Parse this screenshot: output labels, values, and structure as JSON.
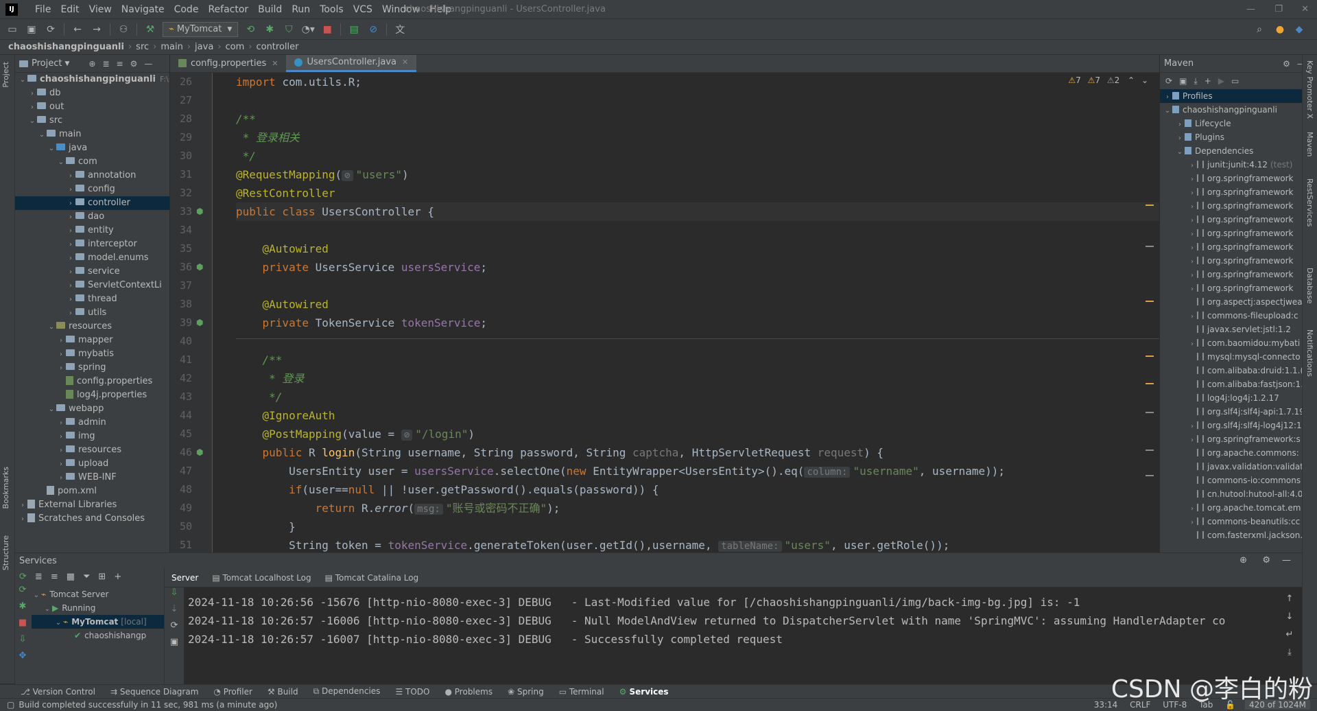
{
  "menubar": {
    "logo": "IJ",
    "items": [
      "File",
      "Edit",
      "View",
      "Navigate",
      "Code",
      "Refactor",
      "Build",
      "Run",
      "Tools",
      "VCS",
      "Window",
      "Help"
    ],
    "window_title": "chaoshishangpinguanli - UsersController.java"
  },
  "toolbar": {
    "run_config": "MyTomcat"
  },
  "breadcrumb": [
    "chaoshishangpinguanli",
    "src",
    "main",
    "java",
    "com",
    "controller"
  ],
  "project": {
    "title": "Project",
    "tree": [
      {
        "label": "chaoshishangpinguanli",
        "hint": "F:\\ssm",
        "depth": 0,
        "arrow": "v",
        "kind": "folder",
        "bold": true
      },
      {
        "label": "db",
        "depth": 1,
        "arrow": ">",
        "kind": "folder"
      },
      {
        "label": "out",
        "depth": 1,
        "arrow": ">",
        "kind": "folder"
      },
      {
        "label": "src",
        "depth": 1,
        "arrow": "v",
        "kind": "folder"
      },
      {
        "label": "main",
        "depth": 2,
        "arrow": "v",
        "kind": "folder"
      },
      {
        "label": "java",
        "depth": 3,
        "arrow": "v",
        "kind": "src"
      },
      {
        "label": "com",
        "depth": 4,
        "arrow": "v",
        "kind": "folder"
      },
      {
        "label": "annotation",
        "depth": 5,
        "arrow": ">",
        "kind": "folder"
      },
      {
        "label": "config",
        "depth": 5,
        "arrow": ">",
        "kind": "folder"
      },
      {
        "label": "controller",
        "depth": 5,
        "arrow": ">",
        "kind": "folder",
        "selected": true
      },
      {
        "label": "dao",
        "depth": 5,
        "arrow": ">",
        "kind": "folder"
      },
      {
        "label": "entity",
        "depth": 5,
        "arrow": ">",
        "kind": "folder"
      },
      {
        "label": "interceptor",
        "depth": 5,
        "arrow": ">",
        "kind": "folder"
      },
      {
        "label": "model.enums",
        "depth": 5,
        "arrow": ">",
        "kind": "folder"
      },
      {
        "label": "service",
        "depth": 5,
        "arrow": ">",
        "kind": "folder"
      },
      {
        "label": "ServletContextLi",
        "depth": 5,
        "arrow": ">",
        "kind": "folder"
      },
      {
        "label": "thread",
        "depth": 5,
        "arrow": ">",
        "kind": "folder"
      },
      {
        "label": "utils",
        "depth": 5,
        "arrow": ">",
        "kind": "folder"
      },
      {
        "label": "resources",
        "depth": 3,
        "arrow": "v",
        "kind": "res"
      },
      {
        "label": "mapper",
        "depth": 4,
        "arrow": ">",
        "kind": "folder"
      },
      {
        "label": "mybatis",
        "depth": 4,
        "arrow": ">",
        "kind": "folder"
      },
      {
        "label": "spring",
        "depth": 4,
        "arrow": ">",
        "kind": "folder"
      },
      {
        "label": "config.properties",
        "depth": 4,
        "arrow": "",
        "kind": "prop"
      },
      {
        "label": "log4j.properties",
        "depth": 4,
        "arrow": "",
        "kind": "prop"
      },
      {
        "label": "webapp",
        "depth": 3,
        "arrow": "v",
        "kind": "folder"
      },
      {
        "label": "admin",
        "depth": 4,
        "arrow": ">",
        "kind": "folder"
      },
      {
        "label": "img",
        "depth": 4,
        "arrow": ">",
        "kind": "folder"
      },
      {
        "label": "resources",
        "depth": 4,
        "arrow": ">",
        "kind": "folder"
      },
      {
        "label": "upload",
        "depth": 4,
        "arrow": ">",
        "kind": "folder"
      },
      {
        "label": "WEB-INF",
        "depth": 4,
        "arrow": ">",
        "kind": "folder"
      },
      {
        "label": "pom.xml",
        "depth": 2,
        "arrow": "",
        "kind": "file"
      },
      {
        "label": "External Libraries",
        "depth": 0,
        "arrow": ">",
        "kind": "lib"
      },
      {
        "label": "Scratches and Consoles",
        "depth": 0,
        "arrow": ">",
        "kind": "lib"
      }
    ]
  },
  "editor": {
    "tabs": [
      {
        "label": "config.properties",
        "active": false
      },
      {
        "label": "UsersController.java",
        "active": true
      }
    ],
    "warnings": {
      "w1": "7",
      "w2": "7",
      "w3": "2"
    },
    "lines": [
      {
        "n": "26",
        "html": "<span class=\"kw\">import </span>com.utils.R;"
      },
      {
        "n": "27",
        "html": ""
      },
      {
        "n": "28",
        "html": "<span class=\"cm\">/**</span>"
      },
      {
        "n": "29",
        "html": "<span class=\"cm\"> * 登录相关</span>"
      },
      {
        "n": "30",
        "html": "<span class=\"cm\"> */</span>"
      },
      {
        "n": "31",
        "html": "<span class=\"an\">@RequestMapping</span>(<span class=\"hint\">⊘</span><span class=\"st\">\"users\"</span>)"
      },
      {
        "n": "32",
        "html": "<span class=\"an\">@RestController</span>"
      },
      {
        "n": "33",
        "html": "<span class=\"kw\">public class </span>UsersController {",
        "cur": true
      },
      {
        "n": "34",
        "html": ""
      },
      {
        "n": "35",
        "html": "    <span class=\"an\">@Autowired</span>"
      },
      {
        "n": "36",
        "html": "    <span class=\"kw\">private </span>UsersService <span class=\"fl\">usersService</span>;"
      },
      {
        "n": "37",
        "html": ""
      },
      {
        "n": "38",
        "html": "    <span class=\"an\">@Autowired</span>"
      },
      {
        "n": "39",
        "html": "    <span class=\"kw\">private </span>TokenService <span class=\"fl\">tokenService</span>;"
      },
      {
        "n": "40",
        "html": ""
      },
      {
        "n": "41",
        "html": "    <span class=\"cm\">/**</span>"
      },
      {
        "n": "42",
        "html": "    <span class=\"cm\"> * 登录</span>"
      },
      {
        "n": "43",
        "html": "    <span class=\"cm\"> */</span>"
      },
      {
        "n": "44",
        "html": "    <span class=\"an\">@IgnoreAuth</span>"
      },
      {
        "n": "45",
        "html": "    <span class=\"an\">@PostMapping</span>(value = <span class=\"hint\">⊘</span><span class=\"st\">\"/login\"</span>)"
      },
      {
        "n": "46",
        "html": "    <span class=\"kw\">public </span>R <span class=\"fn\">login</span>(String username, String password, String <span class=\"dim\">captcha</span>, HttpServletRequest <span class=\"dim\">request</span>) {"
      },
      {
        "n": "47",
        "html": "        UsersEntity user = <span class=\"fl\">usersService</span>.selectOne(<span class=\"kw\">new </span>EntityWrapper&lt;UsersEntity&gt;().eq(<span class=\"hint\">column:</span><span class=\"st\">\"username\"</span>, username));"
      },
      {
        "n": "48",
        "html": "        <span class=\"kw\">if</span>(user==<span class=\"kw\">null </span>|| !user.getPassword().equals(password)) {"
      },
      {
        "n": "49",
        "html": "            <span class=\"kw\">return </span>R.<i>error</i>(<span class=\"hint\">msg:</span><span class=\"st\">\"账号或密码不正确\"</span>);"
      },
      {
        "n": "50",
        "html": "        }"
      },
      {
        "n": "51",
        "html": "        String token = <span class=\"fl\">tokenService</span>.generateToken(user.getId(),username, <span class=\"hint\">tableName:</span><span class=\"st\">\"users\"</span>, user.getRole());"
      }
    ]
  },
  "maven": {
    "title": "Maven",
    "tree": [
      {
        "label": "Profiles",
        "depth": 0,
        "arrow": ">",
        "kind": "folder",
        "selected": true
      },
      {
        "label": "chaoshishangpinguanli",
        "depth": 0,
        "arrow": "v",
        "kind": "folder"
      },
      {
        "label": "Lifecycle",
        "depth": 1,
        "arrow": ">",
        "kind": "folder"
      },
      {
        "label": "Plugins",
        "depth": 1,
        "arrow": ">",
        "kind": "folder"
      },
      {
        "label": "Dependencies",
        "depth": 1,
        "arrow": "v",
        "kind": "folder"
      },
      {
        "label": "junit:junit:4.12",
        "extra": "(test)",
        "depth": 2,
        "arrow": ">",
        "kind": "lib"
      },
      {
        "label": "org.springframework",
        "depth": 2,
        "arrow": ">",
        "kind": "lib"
      },
      {
        "label": "org.springframework",
        "depth": 2,
        "arrow": ">",
        "kind": "lib"
      },
      {
        "label": "org.springframework",
        "depth": 2,
        "arrow": ">",
        "kind": "lib"
      },
      {
        "label": "org.springframework",
        "depth": 2,
        "arrow": ">",
        "kind": "lib"
      },
      {
        "label": "org.springframework",
        "depth": 2,
        "arrow": ">",
        "kind": "lib"
      },
      {
        "label": "org.springframework",
        "depth": 2,
        "arrow": ">",
        "kind": "lib"
      },
      {
        "label": "org.springframework",
        "depth": 2,
        "arrow": ">",
        "kind": "lib"
      },
      {
        "label": "org.springframework",
        "depth": 2,
        "arrow": ">",
        "kind": "lib"
      },
      {
        "label": "org.springframework",
        "depth": 2,
        "arrow": ">",
        "kind": "lib"
      },
      {
        "label": "org.aspectj:aspectjwea",
        "depth": 2,
        "arrow": "",
        "kind": "lib"
      },
      {
        "label": "commons-fileupload:c",
        "depth": 2,
        "arrow": ">",
        "kind": "lib"
      },
      {
        "label": "javax.servlet:jstl:1.2",
        "depth": 2,
        "arrow": "",
        "kind": "lib"
      },
      {
        "label": "com.baomidou:mybati",
        "depth": 2,
        "arrow": ">",
        "kind": "lib"
      },
      {
        "label": "mysql:mysql-connecto",
        "depth": 2,
        "arrow": "",
        "kind": "lib"
      },
      {
        "label": "com.alibaba:druid:1.1.(",
        "depth": 2,
        "arrow": "",
        "kind": "lib"
      },
      {
        "label": "com.alibaba:fastjson:1.",
        "depth": 2,
        "arrow": "",
        "kind": "lib"
      },
      {
        "label": "log4j:log4j:1.2.17",
        "depth": 2,
        "arrow": "",
        "kind": "lib"
      },
      {
        "label": "org.slf4j:slf4j-api:1.7.19",
        "depth": 2,
        "arrow": "",
        "kind": "lib"
      },
      {
        "label": "org.slf4j:slf4j-log4j12:1",
        "depth": 2,
        "arrow": ">",
        "kind": "lib"
      },
      {
        "label": "org.springframework:s",
        "depth": 2,
        "arrow": ">",
        "kind": "lib"
      },
      {
        "label": "org.apache.commons:",
        "depth": 2,
        "arrow": "",
        "kind": "lib"
      },
      {
        "label": "javax.validation:validati",
        "depth": 2,
        "arrow": "",
        "kind": "lib"
      },
      {
        "label": "commons-io:commons",
        "depth": 2,
        "arrow": "",
        "kind": "lib"
      },
      {
        "label": "cn.hutool:hutool-all:4.0",
        "depth": 2,
        "arrow": "",
        "kind": "lib"
      },
      {
        "label": "org.apache.tomcat.em",
        "depth": 2,
        "arrow": ">",
        "kind": "lib"
      },
      {
        "label": "commons-beanutils:cc",
        "depth": 2,
        "arrow": ">",
        "kind": "lib"
      },
      {
        "label": "com.fasterxml.jackson.",
        "depth": 2,
        "arrow": "",
        "kind": "lib"
      }
    ]
  },
  "services": {
    "title": "Services",
    "tree": [
      {
        "label": "Tomcat Server",
        "depth": 0,
        "arrow": "v"
      },
      {
        "label": "Running",
        "depth": 1,
        "arrow": "v"
      },
      {
        "label": "MyTomcat",
        "extra": "[local]",
        "depth": 2,
        "arrow": "v",
        "selected": true
      },
      {
        "label": "chaoshishangp",
        "depth": 3,
        "arrow": ""
      }
    ],
    "log_tabs": [
      "Server",
      "Tomcat Localhost Log",
      "Tomcat Catalina Log"
    ],
    "log_lines": [
      "2024-11-18 10:26:56 -15676 [http-nio-8080-exec-3] DEBUG   - Last-Modified value for [/chaoshishangpinguanli/img/back-img-bg.jpg] is: -1",
      "2024-11-18 10:26:57 -16006 [http-nio-8080-exec-3] DEBUG   - Null ModelAndView returned to DispatcherServlet with name 'SpringMVC': assuming HandlerAdapter co",
      "2024-11-18 10:26:57 -16007 [http-nio-8080-exec-3] DEBUG   - Successfully completed request"
    ]
  },
  "bottom_tabs": [
    "Version Control",
    "Sequence Diagram",
    "Profiler",
    "Build",
    "Dependencies",
    "TODO",
    "Problems",
    "Spring",
    "Terminal",
    "Services"
  ],
  "status": {
    "message": "Build completed successfully in 11 sec, 981 ms (a minute ago)",
    "position": "33:14",
    "line_sep": "CRLF",
    "encoding": "UTF-8",
    "indent": "Tab",
    "memory": "420 of 1024M"
  },
  "side_tabs": {
    "left": [
      "Project",
      "Bookmarks",
      "Structure"
    ],
    "right": [
      "Key Promoter X",
      "Maven",
      "RestServices",
      "Database",
      "Notifications"
    ]
  },
  "watermark": "CSDN @李白的粉"
}
